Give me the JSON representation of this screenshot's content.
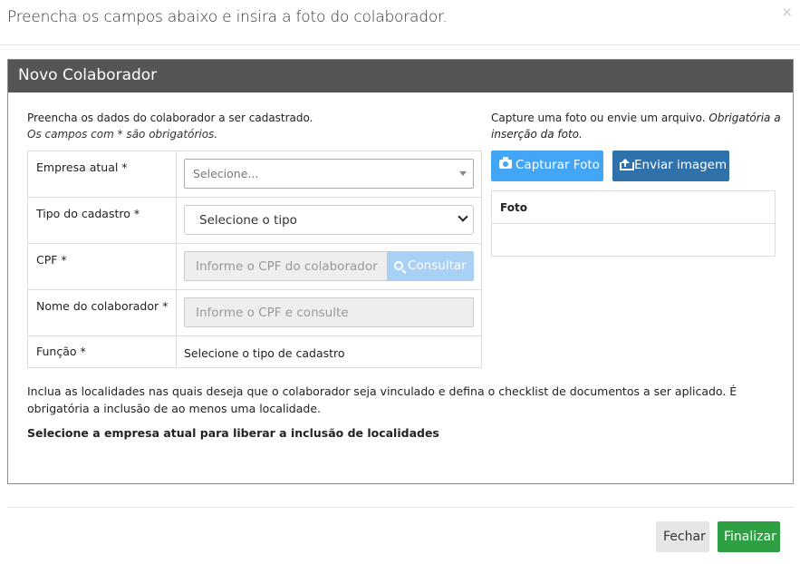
{
  "modal": {
    "title": "Preencha os campos abaixo e insira a foto do colaborador.",
    "close": "×"
  },
  "panel": {
    "heading": "Novo Colaborador"
  },
  "intro": {
    "line1": "Preencha os dados do colaborador a ser cadastrado.",
    "line2": "Os campos com * são obrigatórios."
  },
  "form": {
    "empresa": {
      "label": "Empresa atual *",
      "placeholder": "Selecione..."
    },
    "tipo": {
      "label": "Tipo do cadastro *",
      "value": "Selecione o tipo"
    },
    "cpf": {
      "label": "CPF *",
      "placeholder": "Informe o CPF do colaborador",
      "button": "Consultar"
    },
    "nome": {
      "label": "Nome do colaborador *",
      "placeholder": "Informe o CPF e consulte"
    },
    "funcao": {
      "label": "Função *",
      "value": "Selecione o tipo de cadastro"
    }
  },
  "photo": {
    "intro_plain": "Capture uma foto ou envie um arquivo. ",
    "intro_italic": "Obrigatória a inserção da foto.",
    "capture_button": "Capturar Foto",
    "upload_button": "Enviar imagem",
    "table_header": "Foto"
  },
  "locations": {
    "text": "Inclua as localidades nas quais deseja que o colaborador seja vinculado e defina o checklist de documentos a ser aplicado. É obrigatória a inclusão de ao menos uma localidade.",
    "notice": "Selecione a empresa atual para liberar a inclusão de localidades"
  },
  "footer": {
    "close_button": "Fechar",
    "finish_button": "Finalizar"
  }
}
